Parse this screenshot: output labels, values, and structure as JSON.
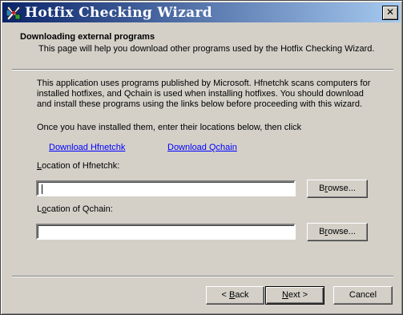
{
  "window": {
    "title": "Hotfix Checking Wizard",
    "close_glyph": "✕"
  },
  "header": {
    "title": "Downloading external programs",
    "description": "This page will help you download other programs used by the Hotfix Checking Wizard."
  },
  "body": {
    "paragraph_line1": "This application uses programs published by Microsoft.  Hfnetchk scans computers for",
    "paragraph_line2": "installed hotfixes, and Qchain is used when installing hotfixes.  You should download",
    "paragraph_line3": "and install these programs using the links below before proceeding with this wizard.",
    "instruction": "Once you have installed them, enter their locations below, then click"
  },
  "links": {
    "download_hfnetchk": "Download Hfnetchk",
    "download_qchain": "Download Qchain"
  },
  "fields": {
    "hfnetchk": {
      "label_pre": "",
      "label_accel": "L",
      "label_post": "ocation of Hfnetchk:",
      "value": ""
    },
    "qchain": {
      "label_pre": "L",
      "label_accel": "o",
      "label_post": "cation of Qchain:",
      "value": ""
    },
    "browse_pre": "B",
    "browse_accel": "r",
    "browse_post": "owse..."
  },
  "buttons": {
    "back_pre": "< ",
    "back_accel": "B",
    "back_post": "ack",
    "next_pre": "",
    "next_accel": "N",
    "next_post": "ext >",
    "cancel": "Cancel"
  },
  "icons": {
    "app": "hotfix-wizard-icon",
    "close": "close-icon"
  }
}
